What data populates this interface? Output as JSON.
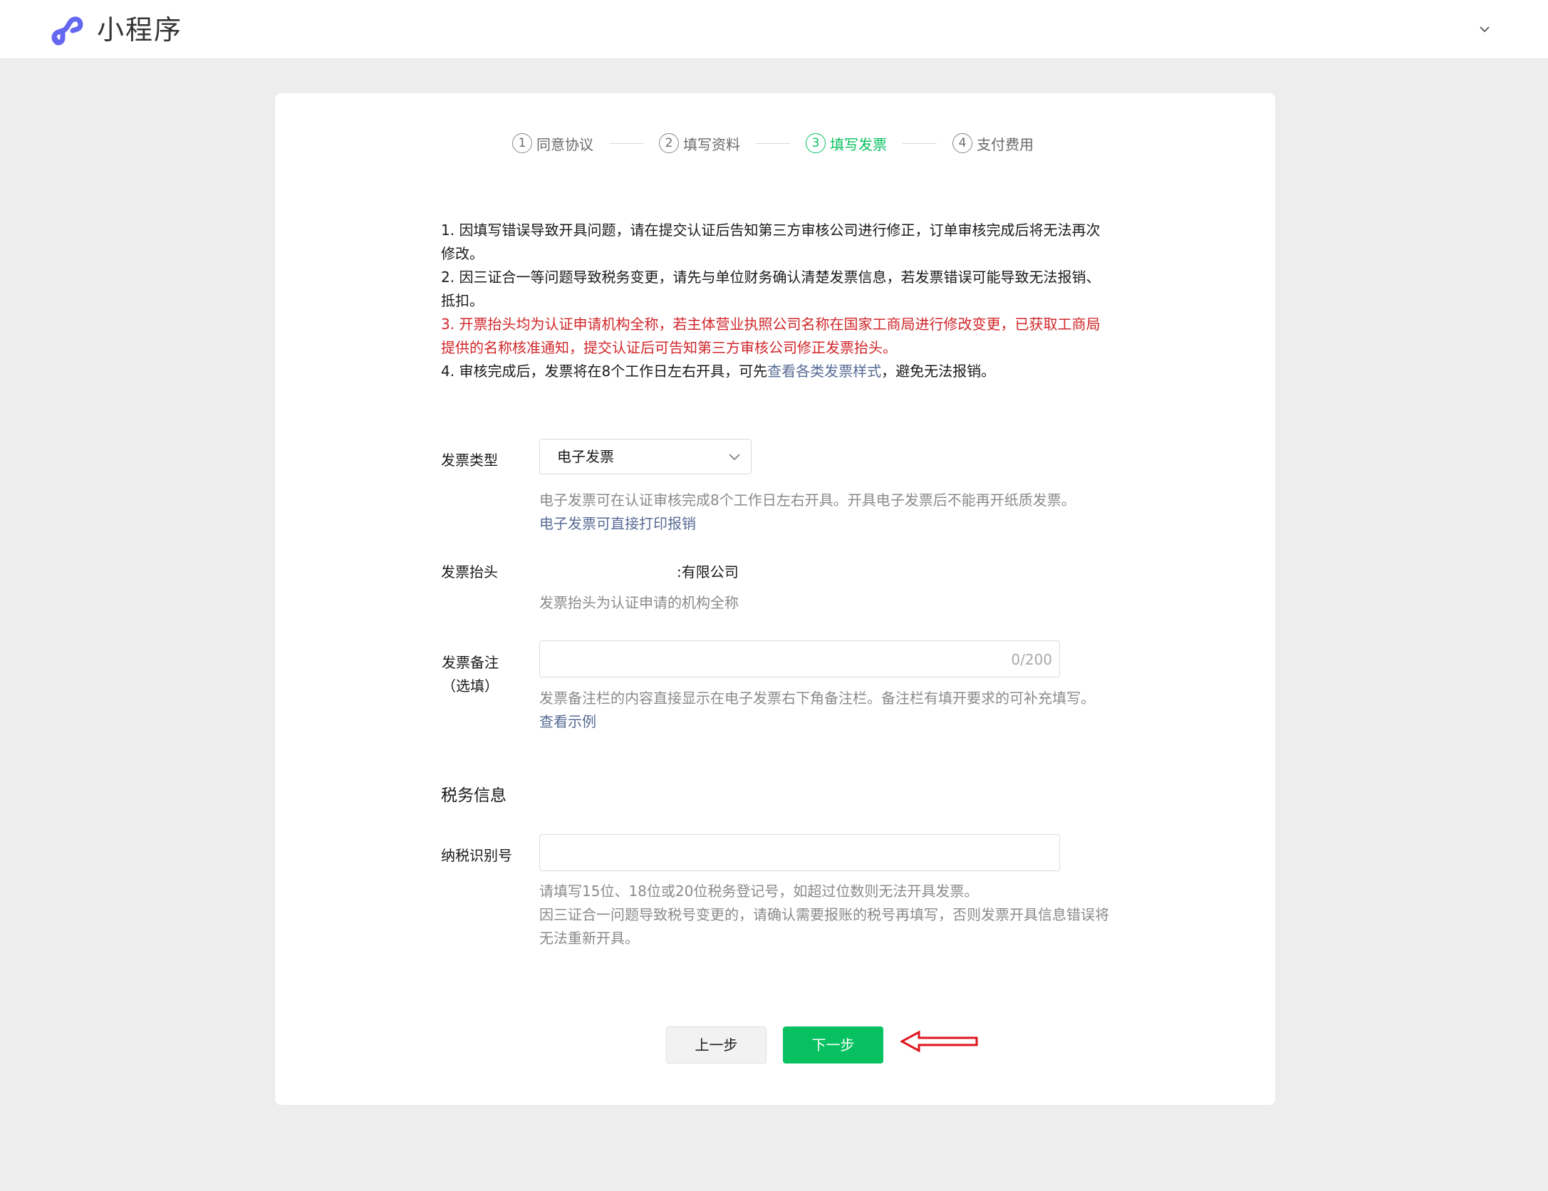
{
  "header": {
    "app_title": "小程序",
    "logo_color": "#6467f0"
  },
  "steps": [
    {
      "num": "1",
      "label": "同意协议",
      "state": "done"
    },
    {
      "num": "2",
      "label": "填写资料",
      "state": "done"
    },
    {
      "num": "3",
      "label": "填写发票",
      "state": "active"
    },
    {
      "num": "4",
      "label": "支付费用",
      "state": "pending"
    }
  ],
  "notice": {
    "line1": "1. 因填写错误导致开具问题，请在提交认证后告知第三方审核公司进行修正，订单审核完成后将无法再次修改。",
    "line2": "2. 因三证合一等问题导致税务变更，请先与单位财务确认清楚发票信息，若发票错误可能导致无法报销、抵扣。",
    "line3": "3. 开票抬头均为认证申请机构全称，若主体营业执照公司名称在国家工商局进行修改变更，已获取工商局提供的名称核准通知，提交认证后可告知第三方审核公司修正发票抬头。",
    "line4_before": "4. 审核完成后，发票将在8个工作日左右开具，可先",
    "line4_link": "查看各类发票样式",
    "line4_after": "，避免无法报销。"
  },
  "invoice_type": {
    "label": "发票类型",
    "selected": "电子发票",
    "hint": "电子发票可在认证审核完成8个工作日左右开具。开具电子发票后不能再开纸质发票。",
    "hint_link": "电子发票可直接打印报销"
  },
  "invoice_title": {
    "label": "发票抬头",
    "value": ":有限公司",
    "hint": "发票抬头为认证申请的机构全称"
  },
  "invoice_remark": {
    "label_line1": "发票备注",
    "label_line2": "（选填）",
    "value": "",
    "counter": "0/200",
    "hint": "发票备注栏的内容直接显示在电子发票右下角备注栏。备注栏有填开要求的可补充填写。",
    "hint_link": "查看示例"
  },
  "tax_section": {
    "title": "税务信息",
    "taxpayer_id_label": "纳税识别号",
    "taxpayer_id_value": "",
    "hint_line1": "请填写15位、18位或20位税务登记号，如超过位数则无法开具发票。",
    "hint_line2": "因三证合一问题导致税号变更的，请确认需要报账的税号再填写，否则发票开具信息错误将无法重新开具。"
  },
  "buttons": {
    "prev": "上一步",
    "next": "下一步"
  },
  "colors": {
    "accent_green": "#07c160",
    "warning_red": "#d0262a",
    "link_blue": "#576b95",
    "annotation_red": "#e0141e"
  }
}
